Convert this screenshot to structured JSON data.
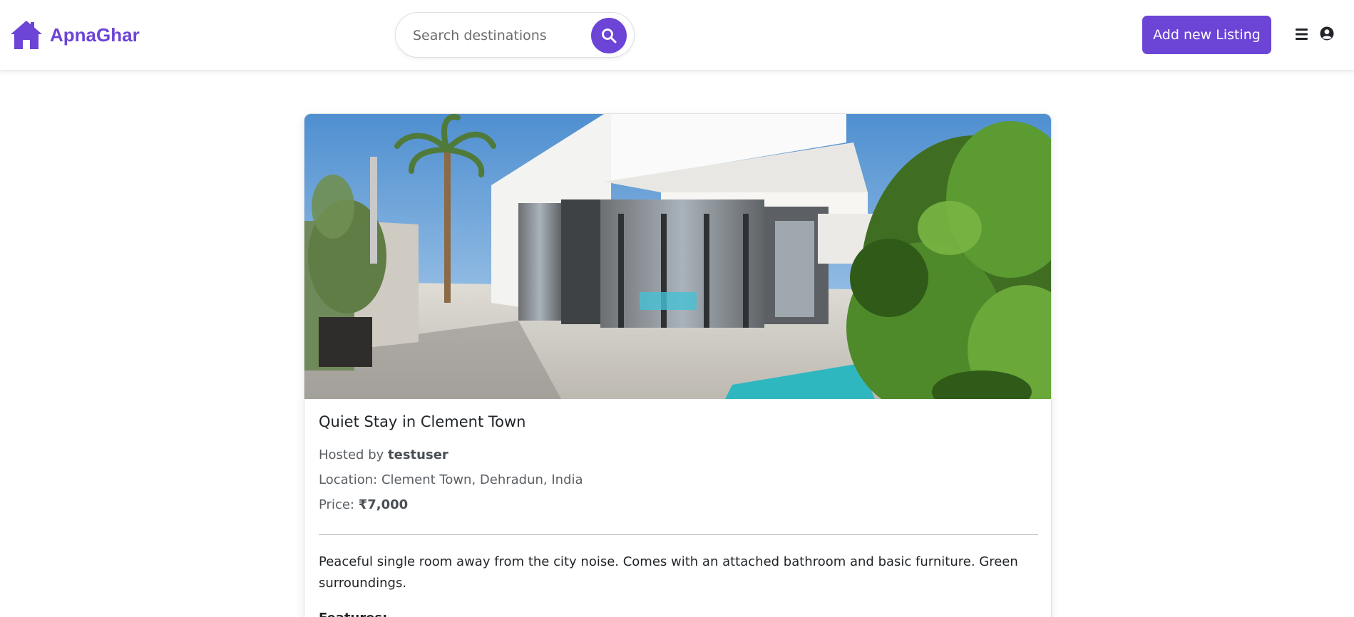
{
  "brand": {
    "name": "ApnaGhar",
    "icon": "house-icon",
    "color": "#6c44d6"
  },
  "search": {
    "placeholder": "Search destinations",
    "icon": "search-icon"
  },
  "nav": {
    "add_listing_label": "Add new Listing",
    "menu_icon": "bars-icon",
    "user_icon": "user-circle-icon"
  },
  "listing": {
    "image_description": "modern-white-villa-with-pool",
    "title": "Quiet Stay in Clement Town",
    "hosted_by_prefix": "Hosted by",
    "host": "testuser",
    "location_label": "Location:",
    "location": "Clement Town, Dehradun, India",
    "price_label": "Price:",
    "price": "₹7,000",
    "description": "Peaceful single room away from the city noise. Comes with an attached bathroom and basic furniture. Green surroundings.",
    "features_label": "Features:"
  },
  "colors": {
    "accent": "#6c44d6",
    "text": "#212529",
    "muted": "#5a5f64"
  }
}
